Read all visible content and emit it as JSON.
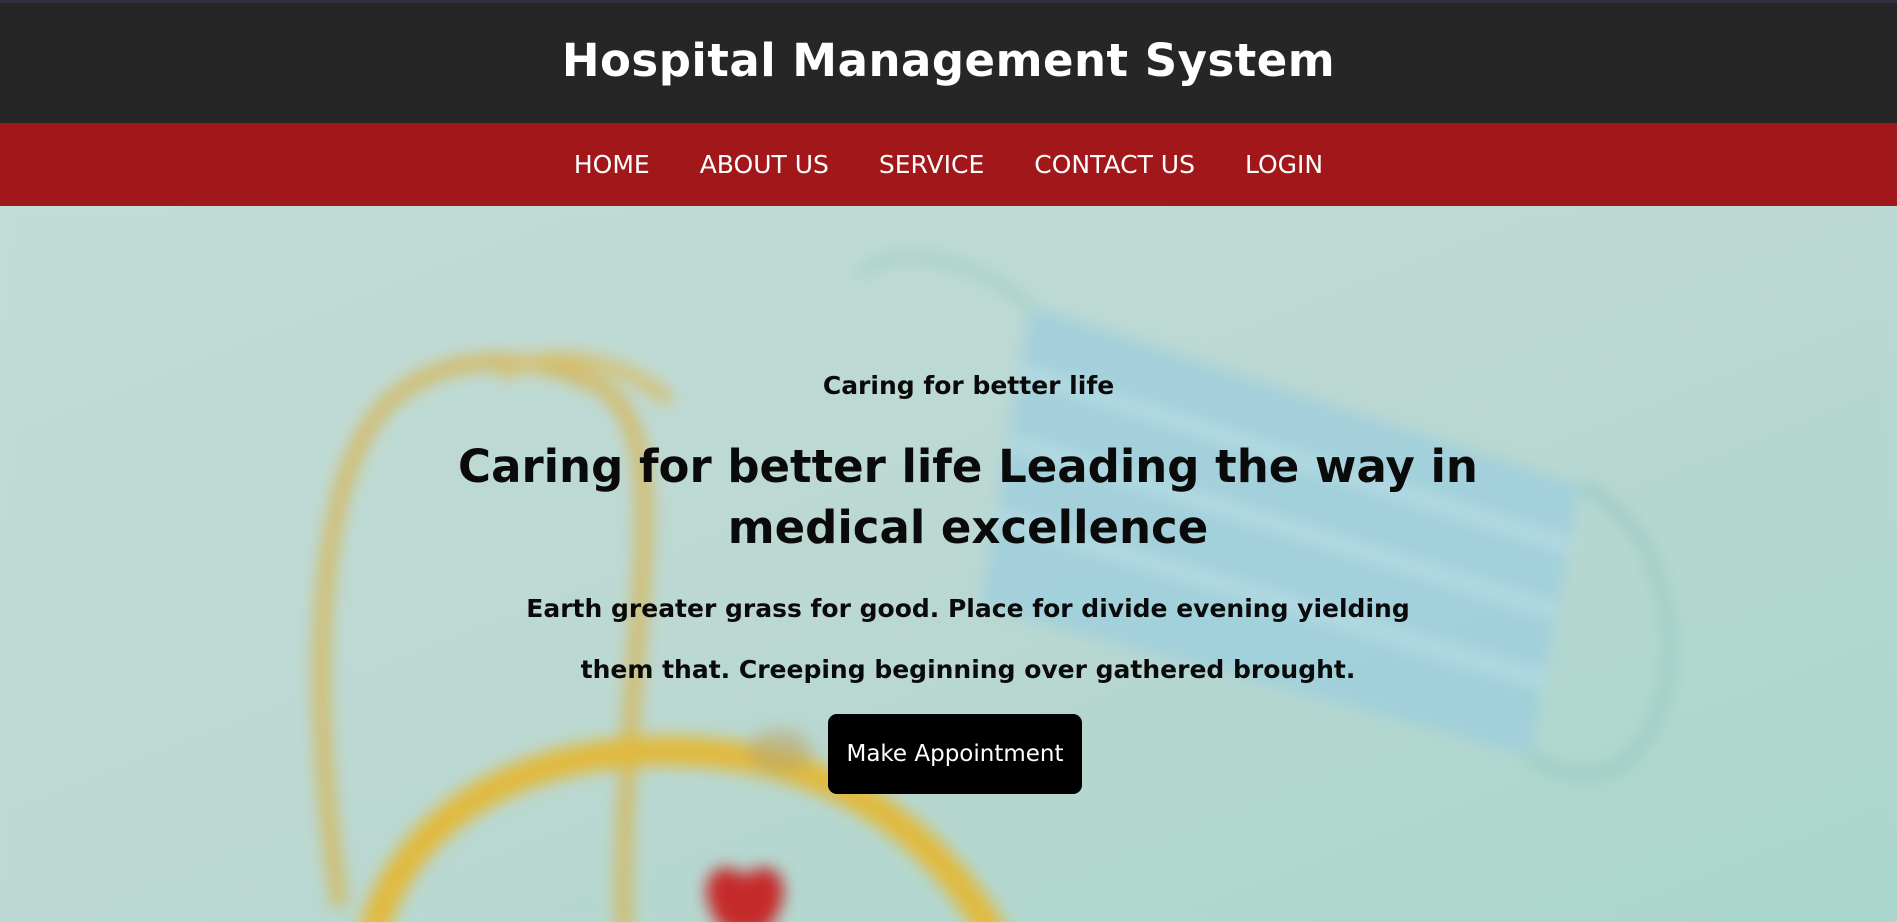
{
  "header": {
    "title": "Hospital Management System"
  },
  "nav": {
    "items": [
      {
        "label": "HOME"
      },
      {
        "label": "ABOUT US"
      },
      {
        "label": "SERVICE"
      },
      {
        "label": "CONTACT US"
      },
      {
        "label": "LOGIN"
      }
    ]
  },
  "hero": {
    "kicker": "Caring for better life",
    "heading": "Caring for better life Leading the way in medical excellence",
    "text": "Earth greater grass for good. Place for divide evening yielding them that. Creeping beginning over gathered brought.",
    "button_label": "Make Appointment"
  },
  "colors": {
    "header_bg": "#262626",
    "nav_bg": "#a21719",
    "button_bg": "#000000",
    "hero_bg": "#b9d8d2"
  }
}
